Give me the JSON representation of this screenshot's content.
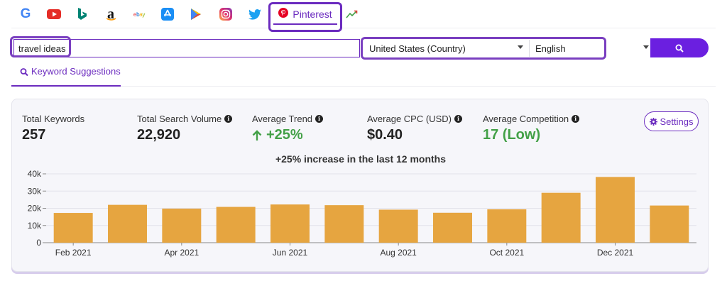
{
  "engines": [
    {
      "name": "google",
      "icon": "google-icon",
      "letter": "G",
      "color": "#4285f4"
    },
    {
      "name": "youtube",
      "icon": "youtube-icon",
      "color": "#e52d27"
    },
    {
      "name": "bing",
      "icon": "bing-icon",
      "color": "#008373"
    },
    {
      "name": "amazon",
      "icon": "amazon-icon",
      "letter": "a",
      "color": "#111111"
    },
    {
      "name": "ebay",
      "icon": "ebay-icon",
      "letter": "ebay",
      "color": "#e53238"
    },
    {
      "name": "app-store",
      "icon": "app-store-icon",
      "color": "#1a8ef5"
    },
    {
      "name": "play-store",
      "icon": "play-store-icon",
      "color": "#34a853"
    },
    {
      "name": "instagram",
      "icon": "instagram-icon",
      "color": "#d6249f"
    },
    {
      "name": "twitter",
      "icon": "twitter-icon",
      "color": "#1da1f2"
    }
  ],
  "active_tab": {
    "label": "Pinterest",
    "icon": "pinterest-icon",
    "color": "#e60023"
  },
  "trends_tab": {
    "icon": "trend-line-icon"
  },
  "search": {
    "keyword": "travel ideas",
    "country": "United States (Country)",
    "language": "English",
    "button_icon": "search-icon"
  },
  "subtab": {
    "label": "Keyword Suggestions",
    "icon": "search-icon"
  },
  "stats": {
    "total_keywords": {
      "label": "Total Keywords",
      "value": "257"
    },
    "total_search_volume": {
      "label": "Total Search Volume",
      "value": "22,920"
    },
    "average_trend": {
      "label": "Average Trend",
      "value": "+25%"
    },
    "average_cpc": {
      "label": "Average CPC (USD)",
      "value": "$0.40"
    },
    "average_competition": {
      "label": "Average Competition",
      "value": "17 (Low)"
    },
    "info_glyph": "i"
  },
  "settings_label": "Settings",
  "colors": {
    "accent": "#6b2bbf",
    "positive": "#43a047",
    "bar": "#e6a540"
  },
  "chart_data": {
    "type": "bar",
    "title": "+25% increase in the last 12 months",
    "categories": [
      "Feb 2021",
      "Mar 2021",
      "Apr 2021",
      "May 2021",
      "Jun 2021",
      "Jul 2021",
      "Aug 2021",
      "Sep 2021",
      "Oct 2021",
      "Nov 2021",
      "Dec 2021",
      "Jan 2022"
    ],
    "xtick_labels": [
      "Feb 2021",
      "",
      "Apr 2021",
      "",
      "Jun 2021",
      "",
      "Aug 2021",
      "",
      "Oct 2021",
      "",
      "Dec 2021",
      ""
    ],
    "values": [
      17300,
      22000,
      19800,
      20800,
      22200,
      21800,
      19200,
      17400,
      19400,
      29000,
      38200,
      21600
    ],
    "ylim": [
      0,
      40000
    ],
    "yticks": [
      "0",
      "10k",
      "20k",
      "30k",
      "40k"
    ],
    "xlabel": "",
    "ylabel": "",
    "grid": true
  }
}
